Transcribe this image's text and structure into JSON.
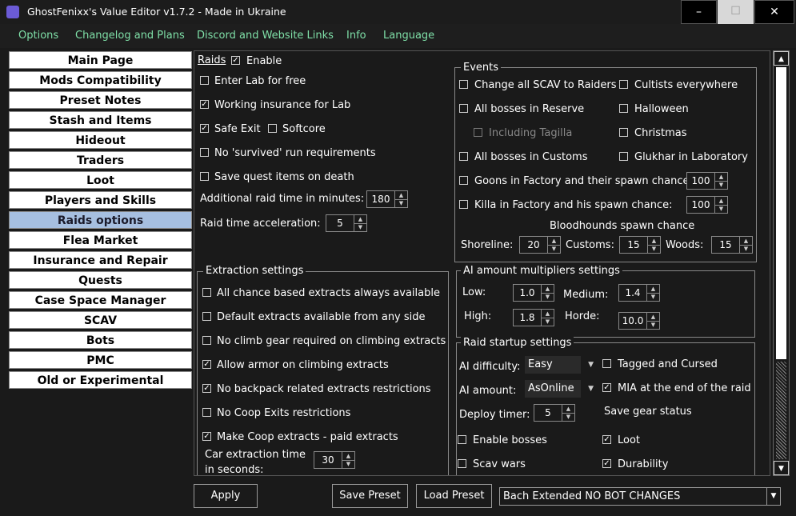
{
  "window": {
    "title": "GhostFenixx's Value Editor v1.7.2 - Made in Ukraine",
    "controls": {
      "minimize": "–",
      "maximize": "☐",
      "close": "✕"
    }
  },
  "menu": [
    "Options",
    "Changelog and Plans",
    "Discord and Website Links",
    "Info",
    "Language"
  ],
  "sidebar": [
    {
      "label": "Main Page"
    },
    {
      "label": "Mods Compatibility"
    },
    {
      "label": "Preset Notes"
    },
    {
      "label": "Stash and Items"
    },
    {
      "label": "Hideout"
    },
    {
      "label": "Traders"
    },
    {
      "label": "Loot"
    },
    {
      "label": "Players and Skills"
    },
    {
      "label": "Raids options",
      "active": true
    },
    {
      "label": "Flea Market"
    },
    {
      "label": "Insurance and Repair"
    },
    {
      "label": "Quests"
    },
    {
      "label": "Case Space Manager"
    },
    {
      "label": "SCAV"
    },
    {
      "label": "Bots"
    },
    {
      "label": "PMC"
    },
    {
      "label": "Old or Experimental"
    }
  ],
  "raids": {
    "header": "Raids",
    "enable": {
      "label": "Enable",
      "checked": true
    },
    "lab_free": {
      "label": "Enter Lab for free",
      "checked": false
    },
    "insurance_lab": {
      "label": "Working insurance for Lab",
      "checked": true
    },
    "safe_exit": {
      "label": "Safe Exit",
      "checked": true
    },
    "softcore": {
      "label": "Softcore",
      "checked": false
    },
    "no_survived": {
      "label": "No 'survived' run requirements",
      "checked": false
    },
    "save_quest": {
      "label": "Save quest items on death",
      "checked": false
    },
    "additional_time": {
      "label": "Additional raid time in minutes:",
      "value": "180"
    },
    "time_accel": {
      "label": "Raid time acceleration:",
      "value": "5"
    }
  },
  "events": {
    "title": "Events",
    "change_scav": {
      "label": "Change all SCAV to Raiders",
      "checked": false
    },
    "cultists": {
      "label": "Cultists everywhere",
      "checked": false
    },
    "bosses_reserve": {
      "label": "All bosses in Reserve",
      "checked": false
    },
    "halloween": {
      "label": "Halloween",
      "checked": false
    },
    "tagilla": {
      "label": "Including Tagilla",
      "checked": false
    },
    "christmas": {
      "label": "Christmas",
      "checked": false
    },
    "bosses_customs": {
      "label": "All bosses in Customs",
      "checked": false
    },
    "glukhar": {
      "label": "Glukhar in Laboratory",
      "checked": false
    },
    "goons": {
      "label": "Goons in Factory and their spawn chance:",
      "checked": false,
      "value": "100"
    },
    "killa": {
      "label": "Killa in Factory and his spawn chance:",
      "checked": false,
      "value": "100"
    },
    "bloodhounds_title": "Bloodhounds spawn chance",
    "shoreline": {
      "label": "Shoreline:",
      "value": "20"
    },
    "customs": {
      "label": "Customs:",
      "value": "15"
    },
    "woods": {
      "label": "Woods:",
      "value": "15"
    }
  },
  "extraction": {
    "title": "Extraction settings",
    "items": [
      {
        "label": "All chance based extracts always available",
        "checked": false
      },
      {
        "label": "Default extracts available from any side",
        "checked": false
      },
      {
        "label": "No climb gear required on climbing extracts",
        "checked": false
      },
      {
        "label": "Allow armor on climbing extracts",
        "checked": true
      },
      {
        "label": "No backpack related extracts restrictions",
        "checked": true
      },
      {
        "label": "No Coop Exits restrictions",
        "checked": false
      },
      {
        "label": "Make Coop extracts - paid extracts",
        "checked": true
      }
    ],
    "car_time_label_1": "Car extraction time",
    "car_time_label_2": "in seconds:",
    "car_time_value": "30"
  },
  "ai_mult": {
    "title": "AI amount multipliers settings",
    "low": {
      "label": "Low:",
      "value": "1.0"
    },
    "medium": {
      "label": "Medium:",
      "value": "1.4"
    },
    "high": {
      "label": "High:",
      "value": "1.8"
    },
    "horde": {
      "label": "Horde:",
      "value": "10.0"
    }
  },
  "startup": {
    "title": "Raid startup settings",
    "ai_difficulty": {
      "label": "AI difficulty:",
      "value": "Easy"
    },
    "ai_amount": {
      "label": "AI amount:",
      "value": "AsOnline"
    },
    "deploy": {
      "label": "Deploy timer:",
      "value": "5"
    },
    "tagged": {
      "label": "Tagged and Cursed",
      "checked": false
    },
    "mia": {
      "label": "MIA at the end of the raid",
      "checked": true
    },
    "save_gear": "Save gear status",
    "enable_bosses": {
      "label": "Enable bosses",
      "checked": false
    },
    "loot": {
      "label": "Loot",
      "checked": true
    },
    "scav_wars": {
      "label": "Scav wars",
      "checked": false
    },
    "durability": {
      "label": "Durability",
      "checked": true
    }
  },
  "bottom": {
    "apply": "Apply",
    "save_preset": "Save Preset",
    "load_preset": "Load Preset",
    "preset_selected": "Bach Extended NO BOT CHANGES"
  }
}
